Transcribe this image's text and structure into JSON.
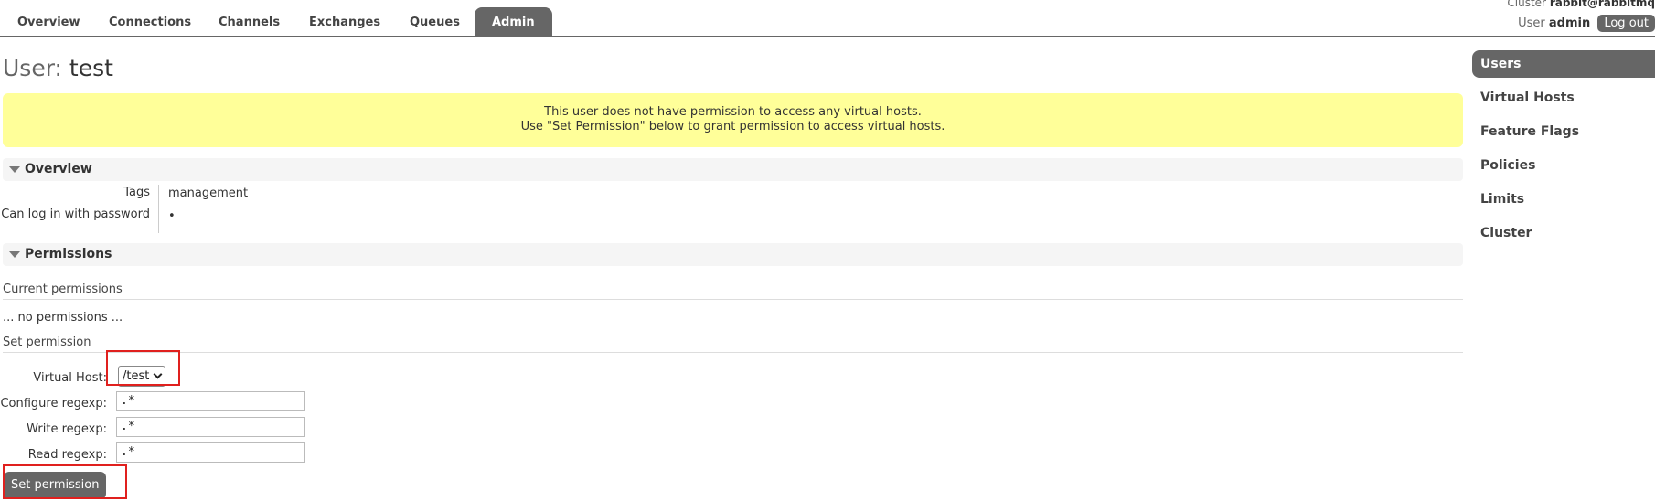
{
  "nav": {
    "tabs": [
      {
        "label": "Overview"
      },
      {
        "label": "Connections"
      },
      {
        "label": "Channels"
      },
      {
        "label": "Exchanges"
      },
      {
        "label": "Queues"
      },
      {
        "label": "Admin",
        "active": true
      }
    ],
    "cluster_label": "Cluster",
    "cluster_value": "rabbit@rabbitmq",
    "user_label": "User",
    "user_value": "admin",
    "logout_label": "Log out"
  },
  "page": {
    "title_label": "User:",
    "title_value": "test",
    "warning_line1": "This user does not have permission to access any virtual hosts.",
    "warning_line2": "Use \"Set Permission\" below to grant permission to access virtual hosts."
  },
  "overview": {
    "header": "Overview",
    "tags_label": "Tags",
    "tags_value": "management",
    "login_label": "Can log in with password",
    "login_value": "•"
  },
  "permissions": {
    "header": "Permissions",
    "current_label": "Current permissions",
    "none_text": "... no permissions ...",
    "set_label": "Set permission",
    "vhost_label": "Virtual Host:",
    "vhost_value": "/test",
    "configure_label": "Configure regexp:",
    "configure_value": ".*",
    "write_label": "Write regexp:",
    "write_value": ".*",
    "read_label": "Read regexp:",
    "read_value": ".*",
    "button_label": "Set permission"
  },
  "sidebar": {
    "items": [
      {
        "label": "Users",
        "active": true
      },
      {
        "label": "Virtual Hosts"
      },
      {
        "label": "Feature Flags"
      },
      {
        "label": "Policies"
      },
      {
        "label": "Limits"
      },
      {
        "label": "Cluster"
      }
    ]
  },
  "colors": {
    "accent": "#666666",
    "warning_bg": "#ffff99",
    "highlight_box": "#e0201e"
  }
}
